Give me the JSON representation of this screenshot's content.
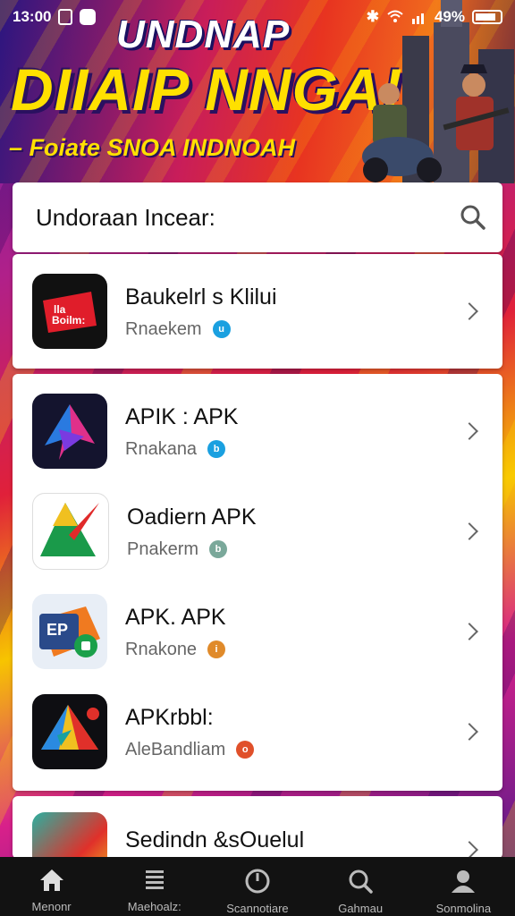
{
  "status_bar": {
    "time": "13:00",
    "battery": "49%"
  },
  "banner": {
    "title_line1": "UNDNAP",
    "title_line2": "DIIAIP NNGA!",
    "subtitle": "– Foiate SNOA INDNOAH"
  },
  "search": {
    "label": "Undoraan Incear:"
  },
  "apps": [
    {
      "name": "Baukelrl s Klilui",
      "sub": "Rnaekem",
      "badge_color": "#1aa0e0",
      "badge_char": "u",
      "icon_text": "lla Boilm:"
    },
    {
      "name": "APIK : APK",
      "sub": "Rnakana",
      "badge_color": "#1aa0e0",
      "badge_char": "b"
    },
    {
      "name": "Oadiern APK",
      "sub": "Pnakerm",
      "badge_color": "#7aa89a",
      "badge_char": "b"
    },
    {
      "name": "APK. APK",
      "sub": "Rnakone",
      "badge_color": "#e08a2a",
      "badge_char": "i",
      "icon_text": "EP"
    },
    {
      "name": "APKrbbl:",
      "sub": "AleBandliam",
      "badge_color": "#e0502a",
      "badge_char": "o"
    },
    {
      "name": "Sedindn &sOuelul",
      "sub": ""
    }
  ],
  "nav": [
    {
      "label": "Menonr",
      "icon": "home-icon"
    },
    {
      "label": "Maehoalz:",
      "icon": "list-icon"
    },
    {
      "label": "Scannotiare",
      "icon": "clock-icon"
    },
    {
      "label": "Gahmau",
      "icon": "search-icon"
    },
    {
      "label": "Sonmolina",
      "icon": "profile-icon"
    }
  ],
  "colors": {
    "banner_yellow": "#ffe000",
    "nav_bg": "#121212"
  }
}
